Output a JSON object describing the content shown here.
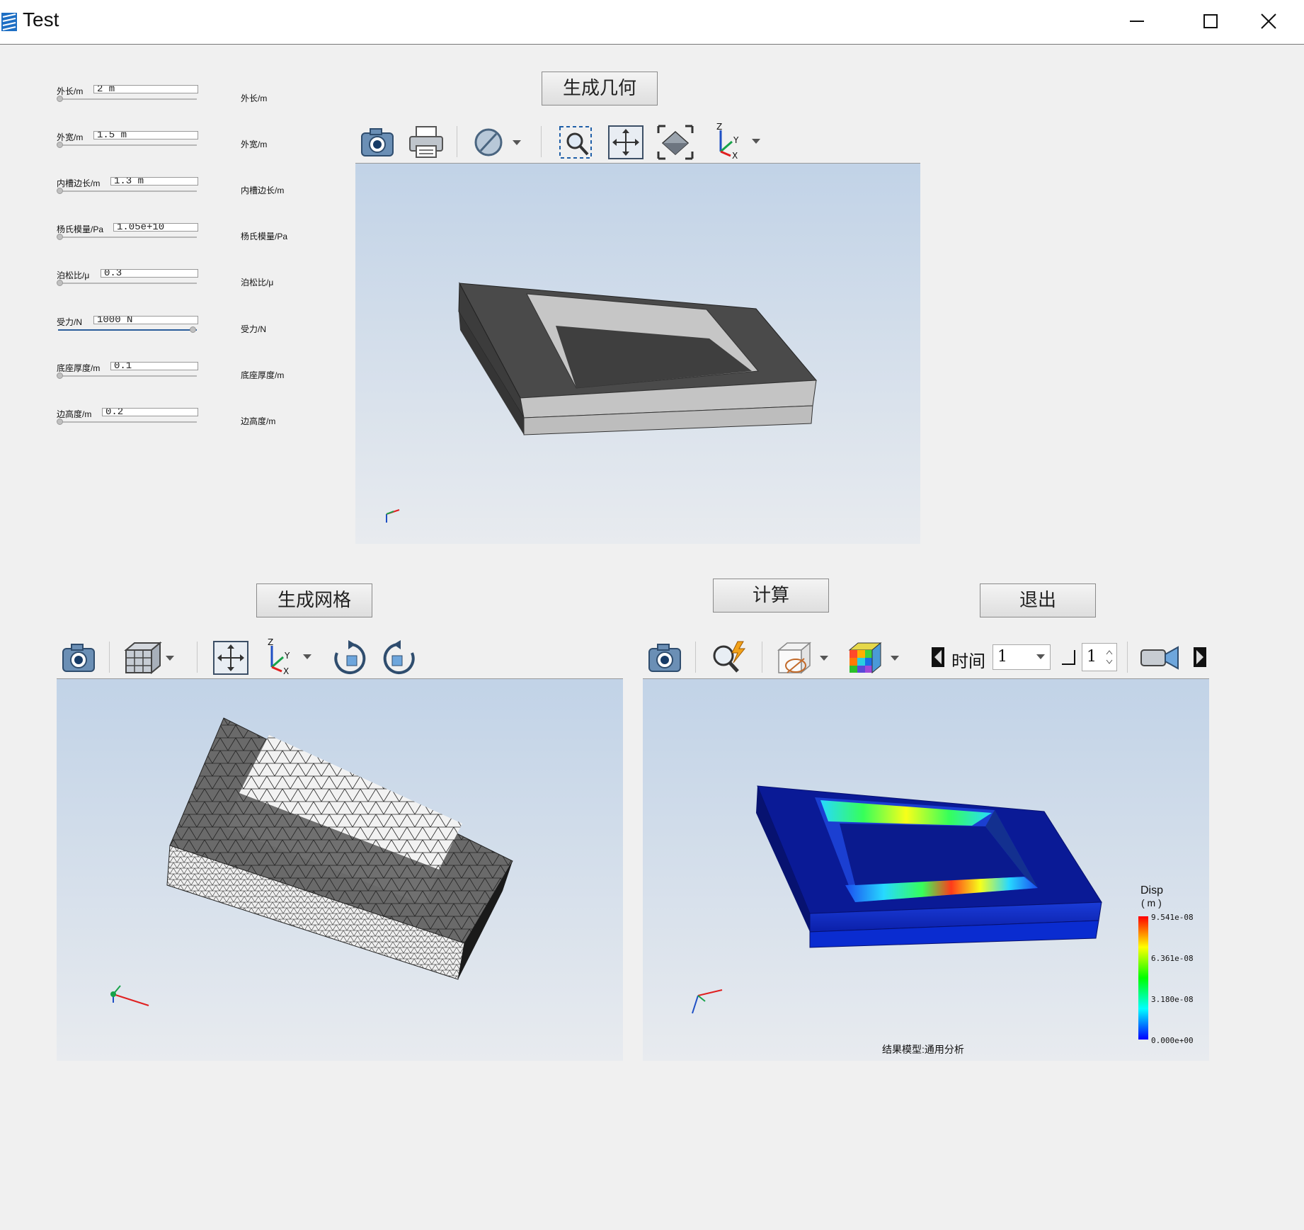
{
  "window": {
    "title": "Test",
    "minimize_icon": "minimize-icon",
    "maximize_icon": "maximize-icon",
    "close_icon": "close-icon"
  },
  "params": [
    {
      "left_label": "外长/m",
      "value": "2 m",
      "right_label": "外长/m",
      "slider_level": 0
    },
    {
      "left_label": "外宽/m",
      "value": "1.5 m",
      "right_label": "外宽/m",
      "slider_level": 0
    },
    {
      "left_label": "内槽边长/m",
      "value": "1.3 m",
      "right_label": "内槽边长/m",
      "slider_level": 0
    },
    {
      "left_label": "杨氏模量/Pa",
      "value": "1.05e+10",
      "right_label": "杨氏模量/Pa",
      "slider_level": 0
    },
    {
      "left_label": "泊松比/μ",
      "value": "0.3",
      "right_label": "泊松比/μ",
      "slider_level": 0
    },
    {
      "left_label": "受力/N",
      "value": "1000 N",
      "right_label": "受力/N",
      "slider_level": 1
    },
    {
      "left_label": "底座厚度/m",
      "value": "0.1",
      "right_label": "底座厚度/m",
      "slider_level": 0
    },
    {
      "left_label": "边高度/m",
      "value": "0.2",
      "right_label": "边高度/m",
      "slider_level": 0
    }
  ],
  "buttons": {
    "generate_geometry": "生成几何",
    "generate_mesh": "生成网格",
    "compute": "计算",
    "exit": "退出"
  },
  "result_toolbar": {
    "time_label": "时间",
    "time_value": "1",
    "step_value": "1"
  },
  "result_legend": {
    "title": "Disp",
    "unit": "( m )",
    "ticks": [
      "9.541e-08",
      "6.361e-08",
      "3.180e-08",
      "0.000e+00"
    ],
    "colors": [
      "#ff0000",
      "#ffff00",
      "#00ff00",
      "#00ffff",
      "#0000ff"
    ]
  },
  "result_footer": "结果模型:通用分析",
  "axis_letters": {
    "x": "X",
    "y": "Y",
    "z": "Z"
  }
}
